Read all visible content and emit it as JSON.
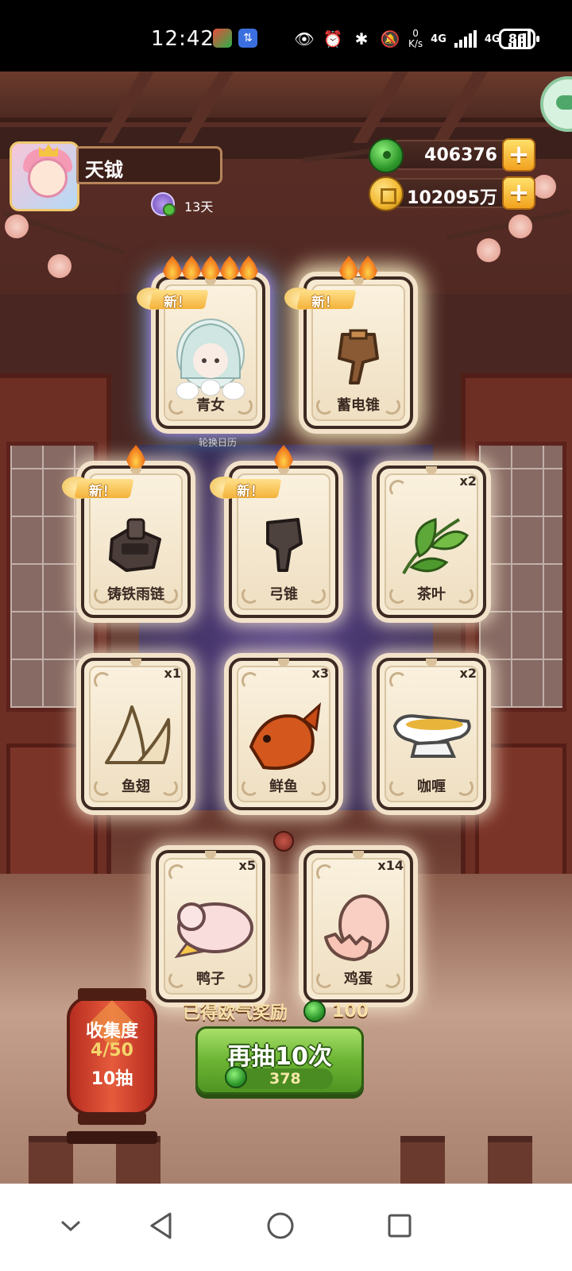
{
  "status_bar": {
    "time": "12:42",
    "net_speed_top": "0",
    "net_speed_bottom": "K/s",
    "sim1": "4G",
    "sim2": "4G",
    "battery": "88"
  },
  "player": {
    "name": "天钺",
    "days": "13天"
  },
  "currency": {
    "jade": "406376",
    "coins": "102095万",
    "plus_label": "+"
  },
  "calendar_label": "轮换日历",
  "new_badge": "新！",
  "cards": [
    {
      "name": "青女",
      "qty": "",
      "is_new": true,
      "flames": 5,
      "highlight": "rainbow"
    },
    {
      "name": "蓄电锥",
      "qty": "",
      "is_new": true,
      "flames": 2,
      "highlight": "glow"
    },
    {
      "name": "铸铁雨链",
      "qty": "",
      "is_new": true,
      "flames": 1,
      "highlight": "normal"
    },
    {
      "name": "弓锥",
      "qty": "",
      "is_new": true,
      "flames": 1,
      "highlight": "normal"
    },
    {
      "name": "茶叶",
      "qty": "x2",
      "is_new": false,
      "flames": 0,
      "highlight": "normal"
    },
    {
      "name": "鱼翅",
      "qty": "x1",
      "is_new": false,
      "flames": 0,
      "highlight": "normal"
    },
    {
      "name": "鲜鱼",
      "qty": "x3",
      "is_new": false,
      "flames": 0,
      "highlight": "normal"
    },
    {
      "name": "咖喱",
      "qty": "x2",
      "is_new": false,
      "flames": 0,
      "highlight": "normal"
    },
    {
      "name": "鸭子",
      "qty": "x5",
      "is_new": false,
      "flames": 0,
      "highlight": "normal"
    },
    {
      "name": "鸡蛋",
      "qty": "x14",
      "is_new": false,
      "flames": 0,
      "highlight": "normal"
    }
  ],
  "reward": {
    "label": "已得欧气奖励",
    "amount": "100"
  },
  "draw_button": {
    "label": "再抽10次",
    "cost": "378"
  },
  "collection": {
    "title": "收集度",
    "progress": "4/50",
    "draws": "10抽"
  },
  "colors": {
    "card_bg": "#f6ead3",
    "button_green": "#6cb434",
    "lantern_red": "#e65a3c",
    "jade_green": "#2f9a2c",
    "coin_gold": "#f1b62d"
  }
}
